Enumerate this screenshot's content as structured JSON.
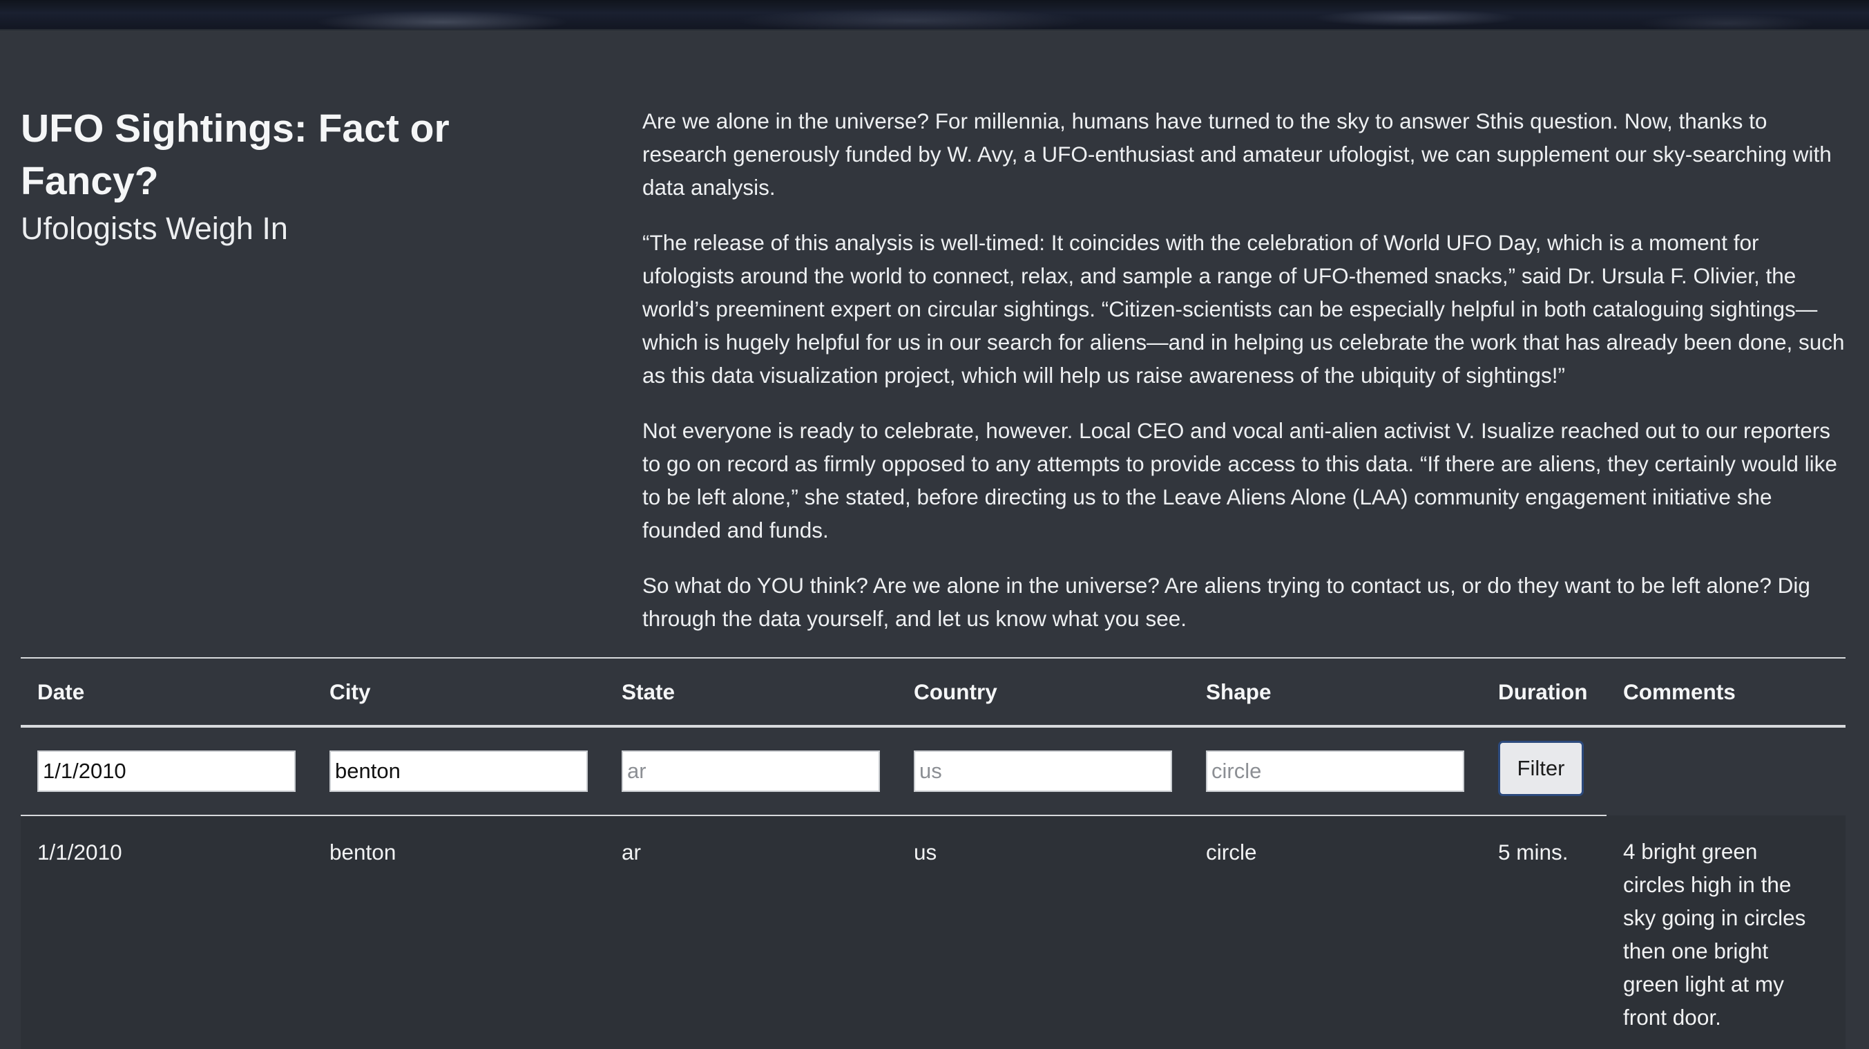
{
  "hero": {},
  "intro": {
    "title": "UFO Sightings: Fact or Fancy?",
    "subtitle": "Ufologists Weigh In",
    "paragraphs": [
      "Are we alone in the universe? For millennia, humans have turned to the sky to answer Sthis question. Now, thanks to research generously funded by W. Avy, a UFO-enthusiast and amateur ufologist, we can supplement our sky-searching with data analysis.",
      "“The release of this analysis is well-timed: It coincides with the celebration of World UFO Day, which is a moment for ufologists around the world to connect, relax, and sample a range of UFO-themed snacks,” said Dr. Ursula F. Olivier, the world’s preeminent expert on circular sightings. “Citizen-scientists can be especially helpful in both cataloguing sightings—which is hugely helpful for us in our search for aliens—and in helping us celebrate the work that has already been done, such as this data visualization project, which will help us raise awareness of the ubiquity of sightings!”",
      "Not everyone is ready to celebrate, however. Local CEO and vocal anti-alien activist V. Isualize reached out to our reporters to go on record as firmly opposed to any attempts to provide access to this data. “If there are aliens, they certainly would like to be left alone,” she stated, before directing us to the Leave Aliens Alone (LAA) community engagement initiative she founded and funds.",
      "So what do YOU think? Are we alone in the universe? Are aliens trying to contact us, or do they want to be left alone? Dig through the data yourself, and let us know what you see."
    ]
  },
  "table": {
    "headers": [
      "Date",
      "City",
      "State",
      "Country",
      "Shape",
      "Duration",
      "Comments"
    ],
    "filters": {
      "date": {
        "value": "1/1/2010",
        "placeholder": ""
      },
      "city": {
        "value": "benton",
        "placeholder": ""
      },
      "state": {
        "value": "",
        "placeholder": "ar"
      },
      "country": {
        "value": "",
        "placeholder": "us"
      },
      "shape": {
        "value": "",
        "placeholder": "circle"
      },
      "button_label": "Filter"
    },
    "rows": [
      {
        "date": "1/1/2010",
        "city": "benton",
        "state": "ar",
        "country": "us",
        "shape": "circle",
        "duration": "5 mins.",
        "comments": "4 bright green circles high in the sky going in circles then one bright green light at my front door."
      }
    ]
  }
}
